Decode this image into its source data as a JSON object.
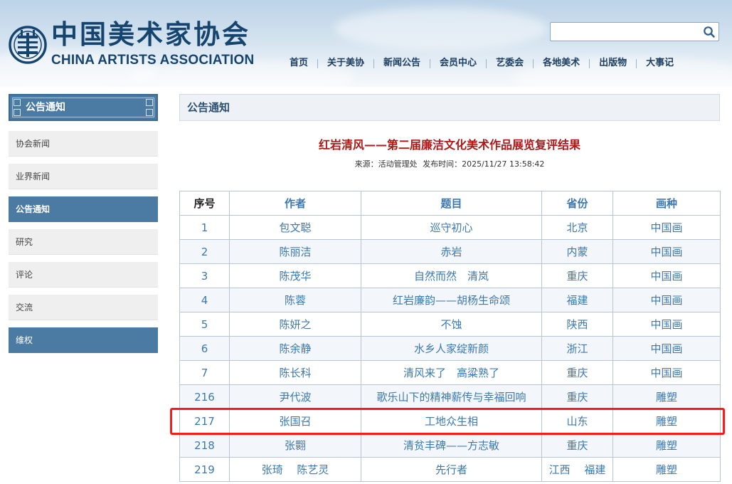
{
  "header": {
    "logo_cn": "中国美术家协会",
    "logo_en": "CHINA ARTISTS ASSOCIATION",
    "search": {
      "placeholder": "",
      "value": "",
      "icon": "search-icon"
    },
    "nav": [
      {
        "label": "首页"
      },
      {
        "label": "关于美协"
      },
      {
        "label": "新闻公告"
      },
      {
        "label": "会员中心"
      },
      {
        "label": "艺委会"
      },
      {
        "label": "各地美术"
      },
      {
        "label": "出版物"
      },
      {
        "label": "大事记"
      }
    ]
  },
  "sidebar": {
    "title": "公告通知",
    "items": [
      {
        "label": "协会新闻",
        "active": false
      },
      {
        "label": "业界新闻",
        "active": false
      },
      {
        "label": "公告通知",
        "active": true
      },
      {
        "label": "研究",
        "active": false
      },
      {
        "label": "评论",
        "active": false
      },
      {
        "label": "交流",
        "active": false
      },
      {
        "label": "维权",
        "active": true
      }
    ]
  },
  "main": {
    "section_title": "公告通知",
    "article_title": "红岩清风——第二届廉洁文化美术作品展览复评结果",
    "meta": {
      "source": "来源：活动管理处",
      "published": "发布时间：2025/11/27 13:58:42"
    },
    "table": {
      "headers": [
        "序号",
        "作者",
        "题目",
        "省份",
        "画种"
      ],
      "rows": [
        [
          "1",
          "包文聪",
          "巡守初心",
          "北京",
          "中国画"
        ],
        [
          "2",
          "陈丽洁",
          "赤岩",
          "内蒙",
          "中国画"
        ],
        [
          "3",
          "陈茂华",
          "自然而然　清岚",
          "重庆",
          "中国画"
        ],
        [
          "4",
          "陈蓉",
          "红岩廉韵——胡杨生命颂",
          "福建",
          "中国画"
        ],
        [
          "5",
          "陈妍之",
          "不蚀",
          "陕西",
          "中国画"
        ],
        [
          "6",
          "陈余静",
          "水乡人家绽新颜",
          "浙江",
          "中国画"
        ],
        [
          "7",
          "陈长科",
          "清风来了　高粱熟了",
          "重庆",
          "中国画"
        ],
        [
          "216",
          "尹代波",
          "歌乐山下的精神薪传与幸福回响",
          "重庆",
          "雕塑"
        ],
        [
          "217",
          "张国召",
          "工地众生相",
          "山东",
          "雕塑"
        ],
        [
          "218",
          "张翾",
          "清贫丰碑——方志敏",
          "重庆",
          "雕塑"
        ],
        [
          "219",
          "张琦　 陈艺灵",
          "先行者",
          "江西　 福建",
          "雕塑"
        ]
      ],
      "highlighted_row_index": 8
    }
  },
  "colors": {
    "accent_blue": "#4b7aa3",
    "title_red": "#b01818",
    "link_blue": "#3c78b0",
    "highlight_red": "#ff1a1a"
  }
}
